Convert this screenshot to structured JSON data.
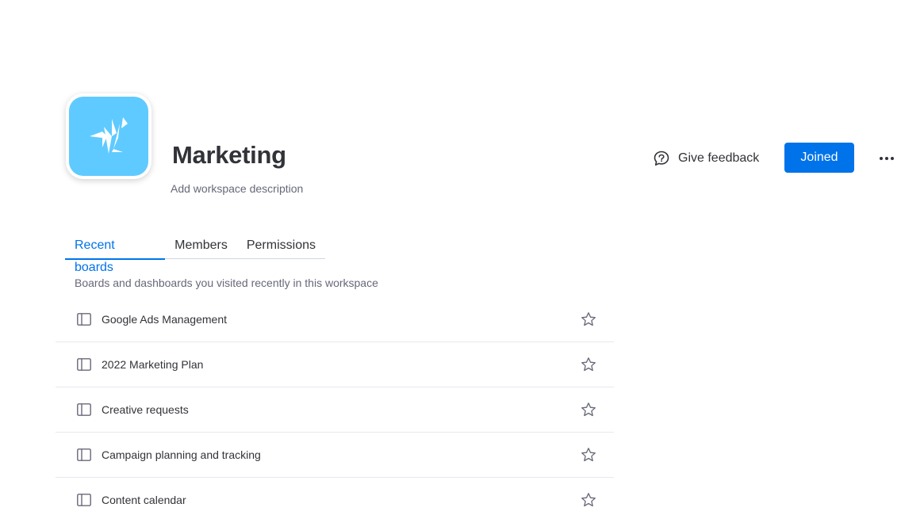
{
  "workspace": {
    "title": "Marketing",
    "description_placeholder": "Add workspace description",
    "logo_color": "#5fcaff"
  },
  "header_actions": {
    "feedback_label": "Give feedback",
    "joined_label": "Joined",
    "more_icon": "more-horizontal-icon",
    "accent_color": "#0073ea"
  },
  "tabs": [
    {
      "label": "Recent boards",
      "active": true
    },
    {
      "label": "Members",
      "active": false
    },
    {
      "label": "Permissions",
      "active": false
    }
  ],
  "recent_boards": {
    "subtitle": "Boards and dashboards you visited recently in this workspace",
    "items": [
      {
        "name": "Google Ads Management",
        "icon": "board-icon",
        "starred": false
      },
      {
        "name": "2022 Marketing Plan",
        "icon": "board-icon",
        "starred": false
      },
      {
        "name": "Creative requests",
        "icon": "board-icon",
        "starred": false
      },
      {
        "name": "Campaign planning and tracking",
        "icon": "board-icon",
        "starred": false
      },
      {
        "name": "Content calendar",
        "icon": "board-icon",
        "starred": false
      }
    ]
  }
}
